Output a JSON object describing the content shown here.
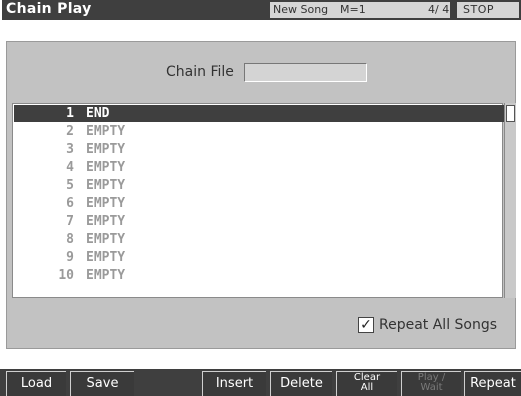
{
  "title_bar": {
    "title": "Chain Play",
    "song_name": "New Song",
    "measure": "M=1",
    "time_signature": "4/ 4",
    "transport_state": "STOP"
  },
  "chain_file": {
    "label": "Chain File",
    "value": ""
  },
  "chain_list": {
    "selected_index": 0,
    "rows": [
      {
        "number": "1",
        "name": "END"
      },
      {
        "number": "2",
        "name": "EMPTY"
      },
      {
        "number": "3",
        "name": "EMPTY"
      },
      {
        "number": "4",
        "name": "EMPTY"
      },
      {
        "number": "5",
        "name": "EMPTY"
      },
      {
        "number": "6",
        "name": "EMPTY"
      },
      {
        "number": "7",
        "name": "EMPTY"
      },
      {
        "number": "8",
        "name": "EMPTY"
      },
      {
        "number": "9",
        "name": "EMPTY"
      },
      {
        "number": "10",
        "name": "EMPTY"
      }
    ]
  },
  "repeat_all": {
    "label": "Repeat All Songs",
    "checked": true,
    "check_mark": "✓"
  },
  "function_bar": {
    "load": "Load",
    "save": "Save",
    "blank": "",
    "insert": "Insert",
    "delete": "Delete",
    "clear_all_line1": "Clear",
    "clear_all_line2": "All",
    "play_wait_line1": "Play /",
    "play_wait_line2": "Wait",
    "repeat": "Repeat"
  },
  "colors": {
    "title_bar": "#3f3f3f",
    "panel": "#c2c2c2",
    "selection": "#3f3f3f",
    "empty_text": "#9a9a9a"
  }
}
